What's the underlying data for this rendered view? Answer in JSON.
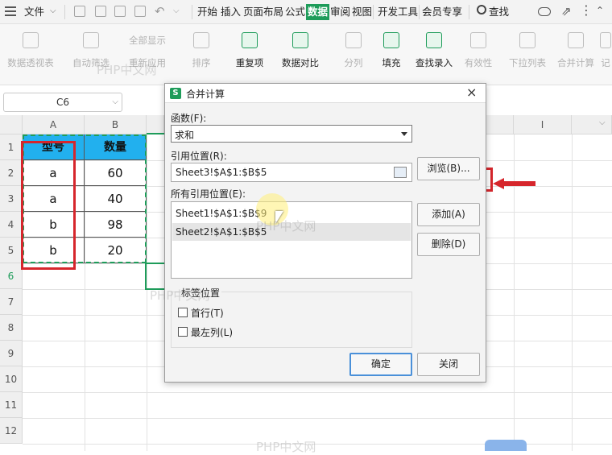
{
  "menubar": {
    "file_label": "文件",
    "tabs": [
      "开始",
      "插入",
      "页面布局",
      "公式",
      "数据",
      "审阅",
      "视图",
      "开发工具",
      "会员专享"
    ],
    "active_tab": "数据",
    "search_label": "查找"
  },
  "ribbon": {
    "buttons": [
      {
        "label": "数据透视表",
        "icon": "pivot-table-icon",
        "enabled": false
      },
      {
        "label": "自动筛选",
        "icon": "filter-icon",
        "enabled": false
      },
      {
        "label": "全部显示",
        "icon": "show-all-icon",
        "enabled": false
      },
      {
        "label": "重新应用",
        "icon": "reapply-icon",
        "enabled": false
      },
      {
        "label": "排序",
        "icon": "sort-icon",
        "enabled": false
      },
      {
        "label": "重复项",
        "icon": "duplicates-icon",
        "enabled": true
      },
      {
        "label": "数据对比",
        "icon": "compare-icon",
        "enabled": true
      },
      {
        "label": "分列",
        "icon": "split-column-icon",
        "enabled": false
      },
      {
        "label": "填充",
        "icon": "fill-icon",
        "enabled": true
      },
      {
        "label": "查找录入",
        "icon": "lookup-entry-icon",
        "enabled": true
      },
      {
        "label": "有效性",
        "icon": "validation-icon",
        "enabled": false
      },
      {
        "label": "下拉列表",
        "icon": "dropdown-list-icon",
        "enabled": false
      },
      {
        "label": "合并计算",
        "icon": "consolidate-icon",
        "enabled": false
      },
      {
        "label": "记",
        "icon": "record-icon",
        "enabled": false
      }
    ]
  },
  "namebox": {
    "value": "C6"
  },
  "grid": {
    "columns": [
      "A",
      "B",
      "",
      "",
      "",
      "",
      "",
      "",
      "I"
    ],
    "rows": [
      "1",
      "2",
      "3",
      "4",
      "5",
      "6",
      "7",
      "8",
      "9",
      "10",
      "11",
      "12"
    ],
    "headers": [
      "型号",
      "数量"
    ],
    "data": [
      [
        "a",
        "60"
      ],
      [
        "a",
        "40"
      ],
      [
        "b",
        "98"
      ],
      [
        "b",
        "20"
      ]
    ]
  },
  "dialog": {
    "title": "合并计算",
    "function_label": "函数(F):",
    "function_value": "求和",
    "ref_label": "引用位置(R):",
    "ref_value": "Sheet3!$A$1:$B$5",
    "browse_button": "浏览(B)...",
    "all_refs_label": "所有引用位置(E):",
    "all_refs": [
      "Sheet1!$A$1:$B$9",
      "Sheet2!$A$1:$B$5"
    ],
    "add_button": "添加(A)",
    "delete_button": "删除(D)",
    "label_group": "标签位置",
    "first_row_label": "首行(T)",
    "first_row_checked": false,
    "left_col_label": "最左列(L)",
    "left_col_checked": false,
    "ok_button": "确定",
    "close_button": "关闭"
  },
  "watermark": "PHP中文网",
  "colors": {
    "accent": "#1e9c5a",
    "header_fill": "#22b0ee",
    "highlight": "#d6262c"
  }
}
